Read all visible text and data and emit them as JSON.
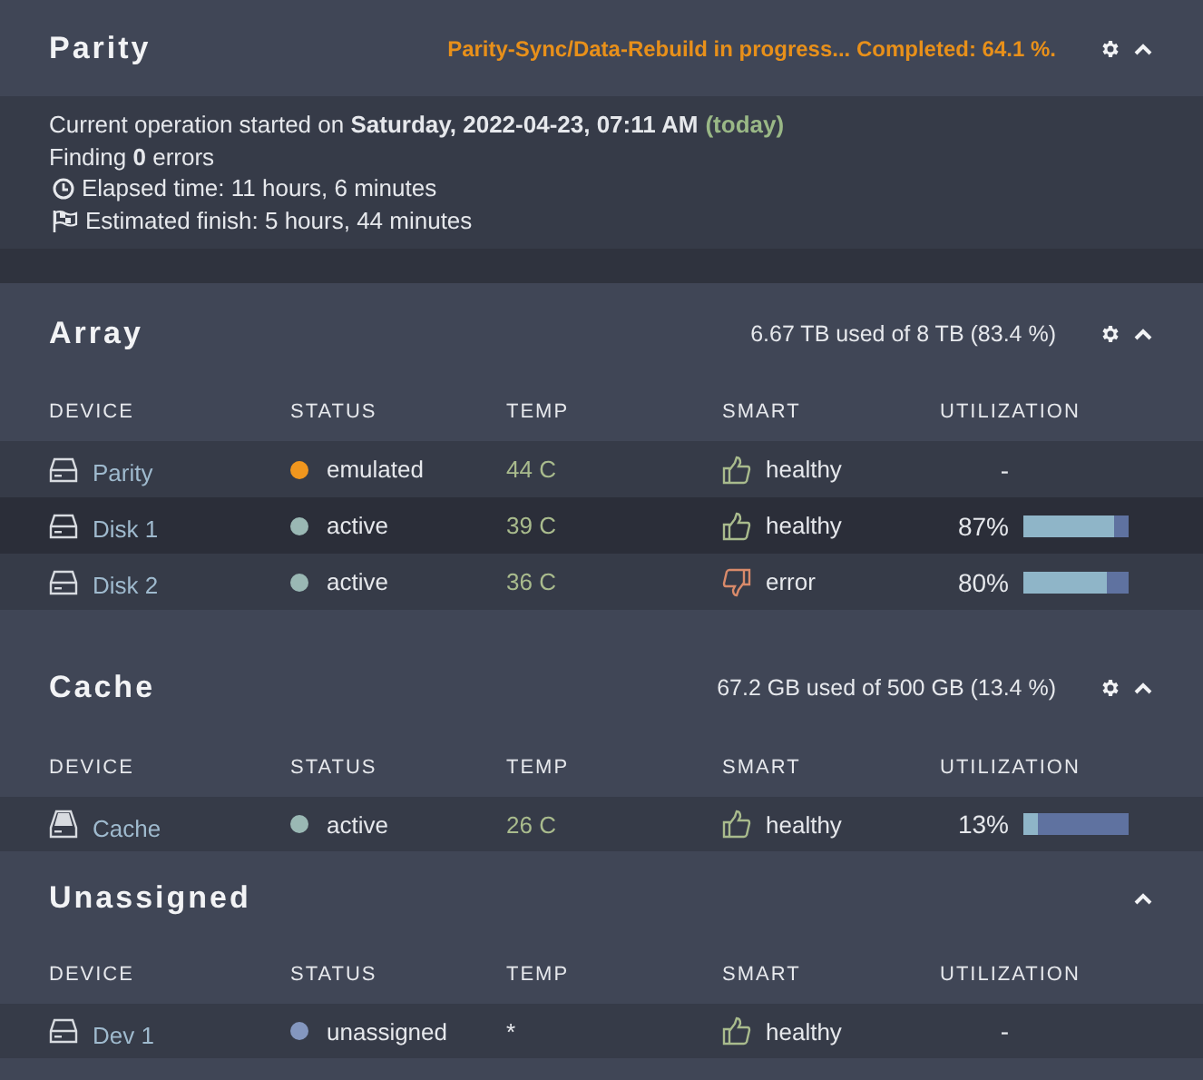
{
  "parity": {
    "title": "Parity",
    "status": "Parity-Sync/Data-Rebuild in progress... Completed: 64.1 %.",
    "settings": true,
    "expanded": true,
    "started": "Current operation started on **Saturday, 2022-04-23, 07:11 AM**",
    "started_note": "(today)",
    "findings": "Finding **0** errors",
    "details": [
      {
        "kind": "clock",
        "text": "Elapsed time: 11 hours, 6 minutes"
      },
      {
        "kind": "flag",
        "text": "Estimated finish: 5 hours, 44 minutes"
      }
    ]
  },
  "sections": [
    {
      "title": "Array",
      "summary": "6.67 TB used of 8 TB (83.4 %)",
      "settings": true,
      "expanded": true,
      "columns": [
        "DEVICE",
        "STATUS",
        "TEMP",
        "SMART",
        "UTILIZATION"
      ],
      "rows": [
        {
          "device": {
            "kind": "disk",
            "name": "Parity"
          },
          "status": {
            "color": "#f0961e",
            "text": "emulated"
          },
          "temp": "44 C",
          "temp_known": true,
          "smart": {
            "kind": "healthy",
            "text": "healthy"
          },
          "utilization": "-",
          "selected": false
        },
        {
          "device": {
            "kind": "disk",
            "name": "Disk 1"
          },
          "status": {
            "color": "#9ab8b4",
            "text": "active"
          },
          "temp": "39 C",
          "temp_known": true,
          "smart": {
            "kind": "healthy",
            "text": "healthy"
          },
          "utilization": "87%",
          "level": 0.87,
          "selected": true
        },
        {
          "device": {
            "kind": "disk",
            "name": "Disk 2"
          },
          "status": {
            "color": "#9ab8b4",
            "text": "active"
          },
          "temp": "36 C",
          "temp_known": true,
          "smart": {
            "kind": "error",
            "text": "error"
          },
          "utilization": "80%",
          "level": 0.8,
          "selected": false
        }
      ]
    },
    {
      "title": "Cache",
      "summary": "67.2 GB used of 500 GB (13.4 %)",
      "settings": true,
      "expanded": true,
      "columns": [
        "DEVICE",
        "STATUS",
        "TEMP",
        "SMART",
        "UTILIZATION"
      ],
      "rows": [
        {
          "device": {
            "kind": "cache",
            "name": "Cache"
          },
          "status": {
            "color": "#9ab8b4",
            "text": "active"
          },
          "temp": "26 C",
          "temp_known": true,
          "smart": {
            "kind": "healthy",
            "text": "healthy"
          },
          "utilization": "13%",
          "level": 0.13,
          "selected": false
        }
      ]
    },
    {
      "title": "Unassigned",
      "settings": false,
      "expanded": true,
      "columns": [
        "DEVICE",
        "STATUS",
        "TEMP",
        "SMART",
        "UTILIZATION"
      ],
      "rows": [
        {
          "device": {
            "kind": "disk",
            "name": "Dev 1"
          },
          "status": {
            "color": "#8497bf",
            "text": "unassigned"
          },
          "temp": "*",
          "temp_known": false,
          "smart": {
            "kind": "healthy",
            "text": "healthy"
          },
          "utilization": "-",
          "selected": false
        }
      ]
    }
  ]
}
